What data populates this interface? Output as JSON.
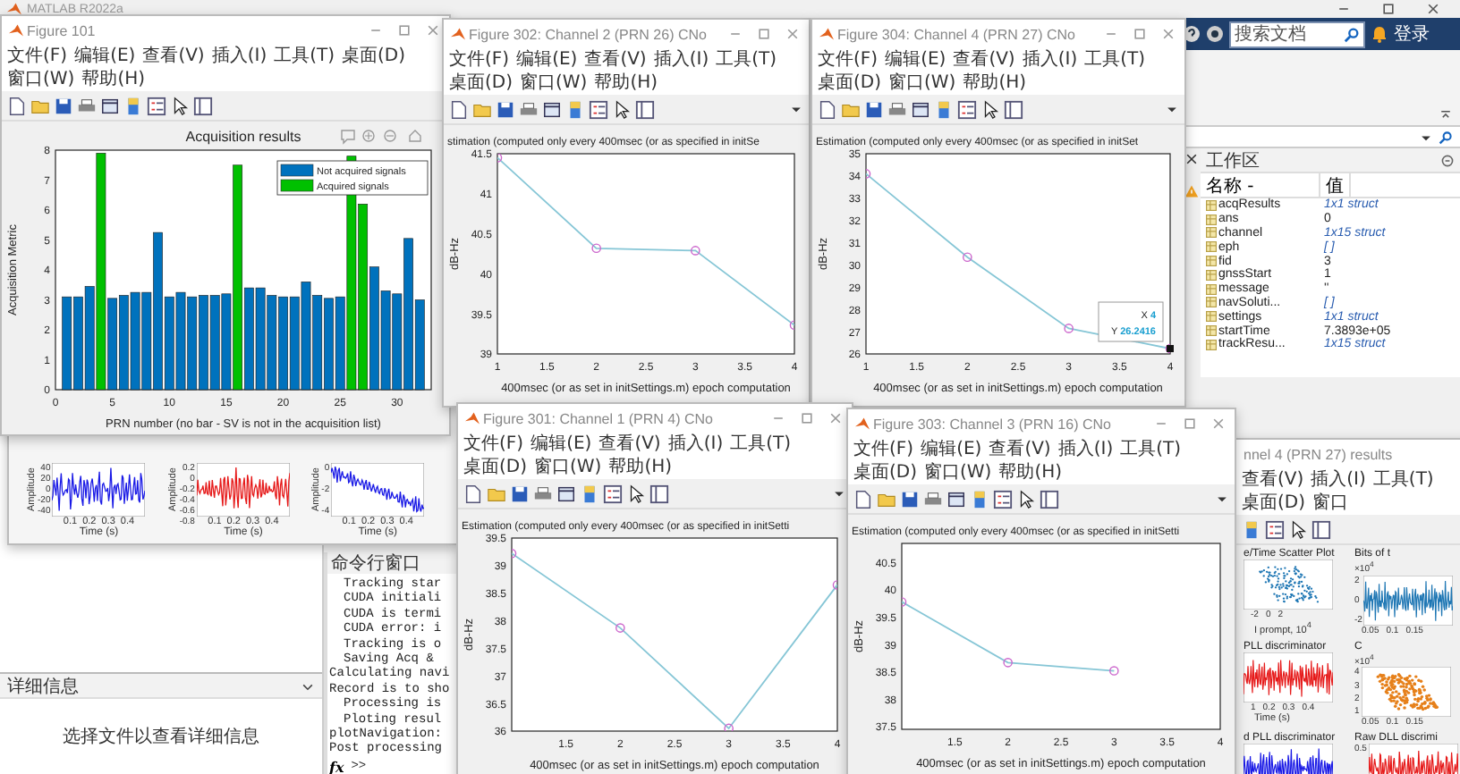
{
  "app": {
    "title": "MATLAB R2022a",
    "search": {
      "placeholder": "搜索文档"
    },
    "login": "登录"
  },
  "workspace": {
    "title": "工作区",
    "columns": [
      "名称 -",
      "值"
    ],
    "rows": [
      {
        "name": "acqResults",
        "value": "1x1 struct",
        "kind": "struct"
      },
      {
        "name": "ans",
        "value": "0",
        "kind": "number"
      },
      {
        "name": "channel",
        "value": "1x15 struct",
        "kind": "struct"
      },
      {
        "name": "eph",
        "value": "[ ]",
        "kind": "struct"
      },
      {
        "name": "fid",
        "value": "3",
        "kind": "number"
      },
      {
        "name": "gnssStart",
        "value": "1",
        "kind": "number"
      },
      {
        "name": "message",
        "value": "''",
        "kind": "number"
      },
      {
        "name": "navSoluti...",
        "value": "[ ]",
        "kind": "struct"
      },
      {
        "name": "settings",
        "value": "1x1 struct",
        "kind": "struct"
      },
      {
        "name": "startTime",
        "value": "7.3893e+05",
        "kind": "number"
      },
      {
        "name": "trackResu...",
        "value": "1x15 struct",
        "kind": "struct"
      }
    ]
  },
  "details": {
    "title": "详细信息",
    "message": "选择文件以查看详细信息"
  },
  "command_window": {
    "title": "命令行窗口",
    "lines": [
      {
        "text": "Tracking star",
        "indented": true
      },
      {
        "text": "CUDA initiali",
        "indented": true
      },
      {
        "text": "CUDA is termi",
        "indented": true
      },
      {
        "text": "CUDA error: i",
        "indented": true
      },
      {
        "text": "Tracking is o",
        "indented": true
      },
      {
        "text": "Saving Acq &",
        "indented": true
      },
      {
        "text": "Calculating navi",
        "indented": false
      },
      {
        "text": "Record is to sho",
        "indented": false
      },
      {
        "text": "Processing is",
        "indented": true
      },
      {
        "text": "Ploting resul",
        "indented": true
      },
      {
        "text": "plotNavigation:",
        "indented": false
      },
      {
        "text": "Post processing",
        "indented": false
      }
    ],
    "function_button": "fx",
    "prompt": ">>"
  },
  "tracking_window": {
    "plots": [
      {
        "kind": "wave",
        "color": "#1a1ae6",
        "ylabel": "Amplitude",
        "xlabel": "Time (s)",
        "xticks": [
          "0.1",
          "0.2",
          "0.3",
          "0.4"
        ],
        "yticks": [
          "40",
          "20",
          "0",
          "-20",
          "-40"
        ]
      },
      {
        "kind": "wave",
        "color": "#e61a1a",
        "ylabel": "Amplitude",
        "xlabel": "Time (s)",
        "xticks": [
          "0.1",
          "0.2",
          "0.3",
          "0.4"
        ],
        "yticks": [
          "0.2",
          "0",
          "-0.2",
          "-0.4",
          "-0.6",
          "-0.8"
        ]
      },
      {
        "kind": "trend",
        "color": "#1a1ae6",
        "ylabel": "Amplitude",
        "xlabel": "Time (s)",
        "xticks": [
          "0.1",
          "0.2",
          "0.3",
          "0.4"
        ],
        "yticks": [
          "0",
          "-2",
          "-4"
        ]
      }
    ]
  },
  "figures": [
    {
      "kind": "bar",
      "title": "Figure 101",
      "menu": [
        "文件(F)",
        "编辑(E)",
        "查看(V)",
        "插入(I)",
        "工具(T)",
        "桌面(D)",
        "窗口(W)",
        "帮助(H)"
      ],
      "chart_data": {
        "type": "bar",
        "title": "Acquisition results",
        "xlabel": "PRN number (no bar - SV is not in the acquisition list)",
        "ylabel": "Acquisition Metric",
        "x": [
          1,
          2,
          3,
          4,
          5,
          6,
          7,
          8,
          9,
          10,
          11,
          12,
          13,
          14,
          15,
          16,
          17,
          18,
          19,
          20,
          21,
          22,
          23,
          24,
          25,
          26,
          27,
          28,
          29,
          30,
          31,
          32
        ],
        "legend": "upper right",
        "series": [
          {
            "name": "Not acquired signals",
            "color": "#0072bd",
            "values": [
              3.1,
              3.1,
              3.45,
              null,
              3.05,
              3.15,
              3.25,
              3.25,
              5.25,
              3.1,
              3.25,
              3.1,
              3.15,
              3.15,
              3.2,
              null,
              3.4,
              3.4,
              3.15,
              3.1,
              3.1,
              3.6,
              3.15,
              3.05,
              3.1,
              null,
              null,
              4.1,
              3.3,
              3.2,
              5.05,
              3.0
            ]
          },
          {
            "name": "Acquired signals",
            "color": "#00c000",
            "values": [
              null,
              null,
              null,
              7.9,
              null,
              null,
              null,
              null,
              null,
              null,
              null,
              null,
              null,
              null,
              null,
              7.5,
              null,
              null,
              null,
              null,
              null,
              null,
              null,
              null,
              null,
              7.8,
              6.2,
              null,
              null,
              null,
              null,
              null
            ]
          }
        ],
        "xlim": [
          0,
          33
        ],
        "ylim": [
          0,
          8
        ],
        "xticks": [
          0,
          5,
          10,
          15,
          20,
          25,
          30
        ],
        "yticks": [
          0,
          1,
          2,
          3,
          4,
          5,
          6,
          7,
          8
        ]
      }
    },
    {
      "kind": "line",
      "title": "Figure 302: Channel 2 (PRN 26) CNo",
      "menu": [
        "文件(F)",
        "编辑(E)",
        "查看(V)",
        "插入(I)",
        "工具(T)",
        "桌面(D)",
        "窗口(W)",
        "帮助(H)"
      ],
      "chart_data": {
        "type": "line",
        "title": "stimation (computed only every 400msec (or as specified in initSe",
        "xlabel": "400msec (or as set in initSettings.m) epoch computation",
        "ylabel": "dB-Hz",
        "x": [
          1,
          2,
          3,
          4
        ],
        "values": [
          41.45,
          40.32,
          40.29,
          39.36
        ],
        "marker": "o",
        "xlim": [
          1,
          4
        ],
        "ylim": [
          39,
          41.5
        ],
        "xticks": [
          1,
          1.5,
          2,
          2.5,
          3,
          3.5,
          4
        ],
        "yticks": [
          39,
          39.5,
          40,
          40.5,
          41,
          41.5
        ]
      }
    },
    {
      "kind": "line",
      "title": "Figure 304: Channel 4 (PRN 27) CNo",
      "menu": [
        "文件(F)",
        "编辑(E)",
        "查看(V)",
        "插入(I)",
        "工具(T)",
        "桌面(D)",
        "窗口(W)",
        "帮助(H)"
      ],
      "chart_data": {
        "type": "line",
        "title": "Estimation (computed only every 400msec (or as specified in initSet",
        "xlabel": "400msec (or as set in initSettings.m) epoch computation",
        "ylabel": "dB-Hz",
        "x": [
          1,
          2,
          3,
          4
        ],
        "values": [
          34.1,
          30.35,
          27.15,
          26.24
        ],
        "marker": "o",
        "xlim": [
          1,
          4
        ],
        "ylim": [
          26,
          35
        ],
        "xticks": [
          1,
          1.5,
          2,
          2.5,
          3,
          3.5,
          4
        ],
        "yticks": [
          26,
          27,
          28,
          29,
          30,
          31,
          32,
          33,
          34,
          35
        ]
      },
      "data_tip": {
        "x_label": "X",
        "x_value": "4",
        "y_label": "Y",
        "y_value": "26.2416"
      }
    },
    {
      "kind": "line",
      "title": "Figure 301: Channel 1 (PRN 4) CNo",
      "menu": [
        "文件(F)",
        "编辑(E)",
        "查看(V)",
        "插入(I)",
        "工具(T)",
        "桌面(D)",
        "窗口(W)",
        "帮助(H)"
      ],
      "chart_data": {
        "type": "line",
        "title": "Estimation (computed only every 400msec (or as specified in initSetti",
        "xlabel": "400msec (or as set in initSettings.m) epoch computation",
        "ylabel": "dB-Hz",
        "x": [
          1,
          2,
          3,
          4
        ],
        "values": [
          39.22,
          37.87,
          36.05,
          38.65
        ],
        "marker": "o",
        "xlim": [
          1,
          4
        ],
        "ylim": [
          36,
          39.5
        ],
        "xticks": [
          1.5,
          2,
          2.5,
          3,
          3.5,
          4
        ],
        "yticks": [
          36,
          36.5,
          37,
          37.5,
          38,
          38.5,
          39,
          39.5
        ]
      }
    },
    {
      "kind": "line",
      "title": "Figure 303: Channel 3 (PRN 16) CNo",
      "menu": [
        "文件(F)",
        "编辑(E)",
        "查看(V)",
        "插入(I)",
        "工具(T)",
        "桌面(D)",
        "窗口(W)",
        "帮助(H)"
      ],
      "chart_data": {
        "type": "line",
        "title": "Estimation (computed only every 400msec (or as specified in initSetti",
        "xlabel": "400msec (or as set in initSettings.m) epoch computation",
        "ylabel": "dB-Hz",
        "x": [
          1,
          2,
          3
        ],
        "values": [
          39.78,
          38.67,
          38.52
        ],
        "marker": "o",
        "xlim": [
          1,
          4
        ],
        "ylim": [
          37.45,
          40.85
        ],
        "xticks": [
          1.5,
          2,
          2.5,
          3,
          3.5,
          4
        ],
        "yticks": [
          37.5,
          38,
          38.5,
          39,
          39.5,
          40,
          40.5
        ]
      }
    }
  ],
  "results_window": {
    "title": "nnel 4 (PRN 27) results",
    "menu": [
      "查看(V)",
      "插入(I)",
      "工具(T)",
      "桌面(D)",
      "窗口"
    ],
    "plots": [
      {
        "kind": "scatter",
        "title": "e/Time Scatter Plot",
        "color": "#1f77b4",
        "xticks": [
          "-2",
          "0",
          "2"
        ],
        "xlabel": "I prompt, 10$^{4}$"
      },
      {
        "kind": "wave",
        "title": "Bits of t",
        "color": "#1f77b4",
        "scale": "×10$^{4}$",
        "yticks": [
          "2",
          "0",
          "-2"
        ],
        "xticks": [
          "0.05",
          "0.1",
          "0.15"
        ]
      },
      {
        "kind": "wave",
        "title": "PLL discriminator",
        "color": "#e61a1a",
        "xticks": [
          "1",
          "0.2",
          "0.3",
          "0.4"
        ],
        "xlabel": "Time (s)"
      },
      {
        "kind": "cloud",
        "title": "C",
        "color": "#e6801a",
        "scale": "×10$^{4}$",
        "yticks": [
          "4",
          "3",
          "2",
          "1"
        ],
        "xticks": [
          "0.05",
          "0.1",
          "0.15"
        ]
      },
      {
        "kind": "wave",
        "title": "d PLL discriminator",
        "color": "#1a1ae6"
      },
      {
        "kind": "wave",
        "title": "Raw DLL discrimi",
        "color": "#e61a1a",
        "yticks": [
          "0.5"
        ]
      }
    ]
  }
}
